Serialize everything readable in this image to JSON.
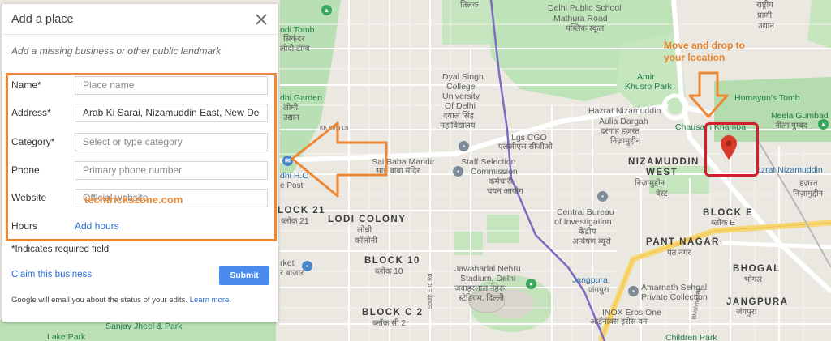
{
  "panel": {
    "title": "Add a place",
    "subtitle": "Add a missing business or other public landmark",
    "fields": {
      "name": {
        "label": "Name*",
        "value": "",
        "placeholder": "Place name"
      },
      "address": {
        "label": "Address*",
        "value": "Arab Ki Sarai, Nizamuddin East, New Delhi,",
        "placeholder": ""
      },
      "category": {
        "label": "Category*",
        "value": "",
        "placeholder": "Select or type category"
      },
      "phone": {
        "label": "Phone",
        "value": "",
        "placeholder": "Primary phone number"
      },
      "website": {
        "label": "Website",
        "value": "",
        "placeholder": "Official website"
      },
      "hours": {
        "label": "Hours",
        "link": "Add hours"
      }
    },
    "watermark": "techtrickszone.com",
    "required_note": "*Indicates required field",
    "claim_link": "Claim this business",
    "submit_label": "Submit",
    "footer_text": "Google will email you about the status of your edits.",
    "footer_link": "Learn more."
  },
  "annotation": {
    "instruction_line1": "Move and drop to",
    "instruction_line2": "your location",
    "accent_color": "#ee8733",
    "highlight_color": "#d11f2b"
  },
  "map": {
    "labels": {
      "delhi_public_school": "Delhi Public School",
      "mathura_road": "Mathura Road",
      "public_school_hi": "पब्लिक स्कूल",
      "rashtriya_hi": "राष्ट्रीय",
      "prani_hi": "प्राणी",
      "udyan_hi": "उद्यान",
      "tikas_hi": "तिलक",
      "lodi_tomb": "odi Tomb",
      "lodi_tomb_hi1": "सिकंदर",
      "lodi_tomb_hi2": "लोदी टॉम्ब",
      "lodhi_garden": "dhi Garden",
      "lodhi_garden_hi1": "लोधी",
      "lodhi_garden_hi2": "उद्यान",
      "kk_birla": "KK Birla Ln",
      "dyal_singh_1": "Dyal Singh",
      "dyal_singh_2": "College",
      "dyal_singh_3": "University",
      "dyal_singh_4": "Of Delhi",
      "dyal_singh_hi1": "दयाल सिंह",
      "dyal_singh_hi2": "महाविद्यालय",
      "amir_khusro_1": "Amir",
      "amir_khusro_2": "Khusro Park",
      "humayun_tomb": "Humayun's Tomb",
      "neela_gumbad": "Neela Gumbad",
      "neela_gumbad_hi": "नीला गुम्बद",
      "hazrat_dargah_1": "Hazrat Nizamuddin",
      "hazrat_dargah_2": "Aulia Dargah",
      "hazrat_dargah_hi1": "दरगाह हज़रत",
      "hazrat_dargah_hi2": "निज़ामुद्दीन",
      "chausath_khamba": "Chausath Khamba",
      "lgs_cgo": "Lgs CGO",
      "lgs_cgo_hi": "एलजीएस सीजीओ",
      "sai_baba": "Sai Baba Mandir",
      "sai_baba_hi": "साईं बाबा मंदिर",
      "ssc_1": "Staff Selection",
      "ssc_2": "Commission",
      "ssc_hi1": "कर्मचारी",
      "ssc_hi2": "चयन आयोग",
      "nizamuddin_west": "NIZAMUDDIN",
      "nizamuddin_west_2": "WEST",
      "nizamuddin_west_hi1": "निज़ामुद्दीन",
      "nizamuddin_west_hi2": "वेस्ट",
      "hazrat_nizamuddin": "azrat Nizamuddin",
      "hazrat_nizamuddin_hi": "हज़रत",
      "hazrat_nizamuddin_hi2": "निज़ामुद्दीन",
      "lodi_colony": "LODI COLONY",
      "lodi_colony_hi1": "लोधी",
      "lodi_colony_hi2": "कॉलोनी",
      "block_21": "LOCK 21",
      "block_21_hi": "ब्लॉक 21",
      "lodhi_ho": "dhi H.O",
      "lodhi_ho_2": "e Post",
      "cbi_1": "Central Bureau",
      "cbi_2": "of Investigation",
      "cbi_hi1": "केंद्रीय",
      "cbi_hi2": "अन्वेषण ब्यूरो",
      "block_e": "BLOCK E",
      "block_e_hi": "ब्लॉक E",
      "pant_nagar": "PANT NAGAR",
      "pant_nagar_hi": "पंत नगर",
      "block_10": "BLOCK 10",
      "block_10_hi": "ब्लॉक 10",
      "market": "rket",
      "market_hi": "र बाज़ार",
      "jln_1": "Jawaharlal Nehru",
      "jln_2": "Stadium, Delhi",
      "jln_hi1": "जवाहरलाल नेहरू",
      "jln_hi2": "स्टेडियम, दिल्ली",
      "jangpura_stn": "Jangpura",
      "jangpura_stn_hi": "जंगपुरा",
      "amarnath_1": "Amarnath Sehgal",
      "amarnath_2": "Private Collection",
      "bhogal": "BHOGAL",
      "bhogal_hi": "भोगल",
      "block_c2": "BLOCK C 2",
      "block_c2_hi": "ब्लॉक सी 2",
      "jangpura": "JANGPURA",
      "jangpura_hi": "जंगपुरा",
      "inox": "INOX Eros One",
      "inox_hi": "आईनॉक्स इरोस वन",
      "sanjay_jheel": "Sanjay Jheel & Park",
      "lake_park": "Lake Park",
      "children_park": "Children Park",
      "south_end_rd": "South End Rd",
      "bhishma_rd": "Bhishma Rd"
    }
  }
}
